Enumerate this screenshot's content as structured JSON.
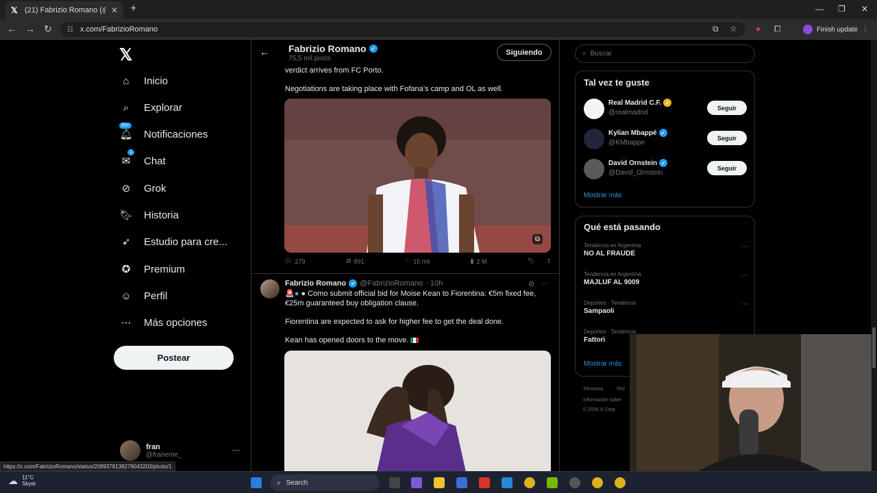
{
  "browser": {
    "tab_title": "(21) Fabrizio Romano (@Fabrizi",
    "url": "x.com/FabrizioRomano",
    "finish_update": "Finish update",
    "status_url": "https://x.com/FabrizioRomano/status/2089378138279043203/photo/1"
  },
  "nav": {
    "items": [
      {
        "label": "Inicio",
        "icon": "home-icon"
      },
      {
        "label": "Explorar",
        "icon": "search-icon"
      },
      {
        "label": "Notificaciones",
        "icon": "bell-icon",
        "badge": "20+"
      },
      {
        "label": "Chat",
        "icon": "chat-icon",
        "badge": "1"
      },
      {
        "label": "Grok",
        "icon": "grok-icon"
      },
      {
        "label": "Historia",
        "icon": "bookmark-icon"
      },
      {
        "label": "Estudio para cre...",
        "icon": "rocket-icon"
      },
      {
        "label": "Premium",
        "icon": "verified-icon"
      },
      {
        "label": "Perfil",
        "icon": "person-icon"
      },
      {
        "label": "Más opciones",
        "icon": "more-circle-icon"
      }
    ],
    "post_button": "Postear",
    "user_name": "fran",
    "user_handle": "@franeme_"
  },
  "profile_header": {
    "name": "Fabrizio Romano",
    "posts": "75,5 mil posts",
    "following_button": "Siguiendo"
  },
  "tweet1": {
    "text_top": "verdict arrives from FC Porto.",
    "text_2": "Negotiations are taking place with Fofana’s camp and OL as well.",
    "replies": "279",
    "retweets": "891",
    "likes": "15 mil",
    "views": "2 M"
  },
  "tweet2": {
    "name": "Fabrizio Romano",
    "handle": "@FabrizioRomano",
    "time": "· 10h",
    "line1": "Como submit official bid for Moise Kean to Fiorentina: €5m fixed fee, €25m guaranteed buy obligation clause.",
    "line2": "Fiorentina are expected to ask for higher fee to get the deal done.",
    "line3": "Kean has opened doors to the move."
  },
  "sidebar": {
    "search_placeholder": "Buscar",
    "suggest_title": "Tal vez te guste",
    "suggestions": [
      {
        "name": "Real Madrid C.F.",
        "handle": "@realmadrid",
        "button": "Seguir"
      },
      {
        "name": "Kylian Mbappé",
        "handle": "@KMbappe",
        "button": "Seguir"
      },
      {
        "name": "David Ornstein",
        "handle": "@David_Ornstein",
        "button": "Seguir"
      }
    ],
    "show_more": "Mostrar más",
    "trends_title": "Qué está pasando",
    "trends": [
      {
        "context": "Tendencia en Argentina",
        "name": "NO AL FRAUDE"
      },
      {
        "context": "Tendencia en Argentina",
        "name": "MAJLUF AL 9009"
      },
      {
        "context": "Deportes · Tendencia",
        "name": "Sampaoli"
      },
      {
        "context": "Deportes · Tendencia",
        "name": "Fattori"
      }
    ],
    "show_more_trends": "Mostrar más",
    "footer1": "Términos",
    "footer1b": "Priv",
    "footer2": "Información sobre",
    "footer3": "© 2026 X Corp."
  },
  "taskbar": {
    "temp": "11°C",
    "weather": "Skyet",
    "search": "Search"
  },
  "colors": {
    "accent": "#1d9bf0",
    "background": "#000000"
  }
}
